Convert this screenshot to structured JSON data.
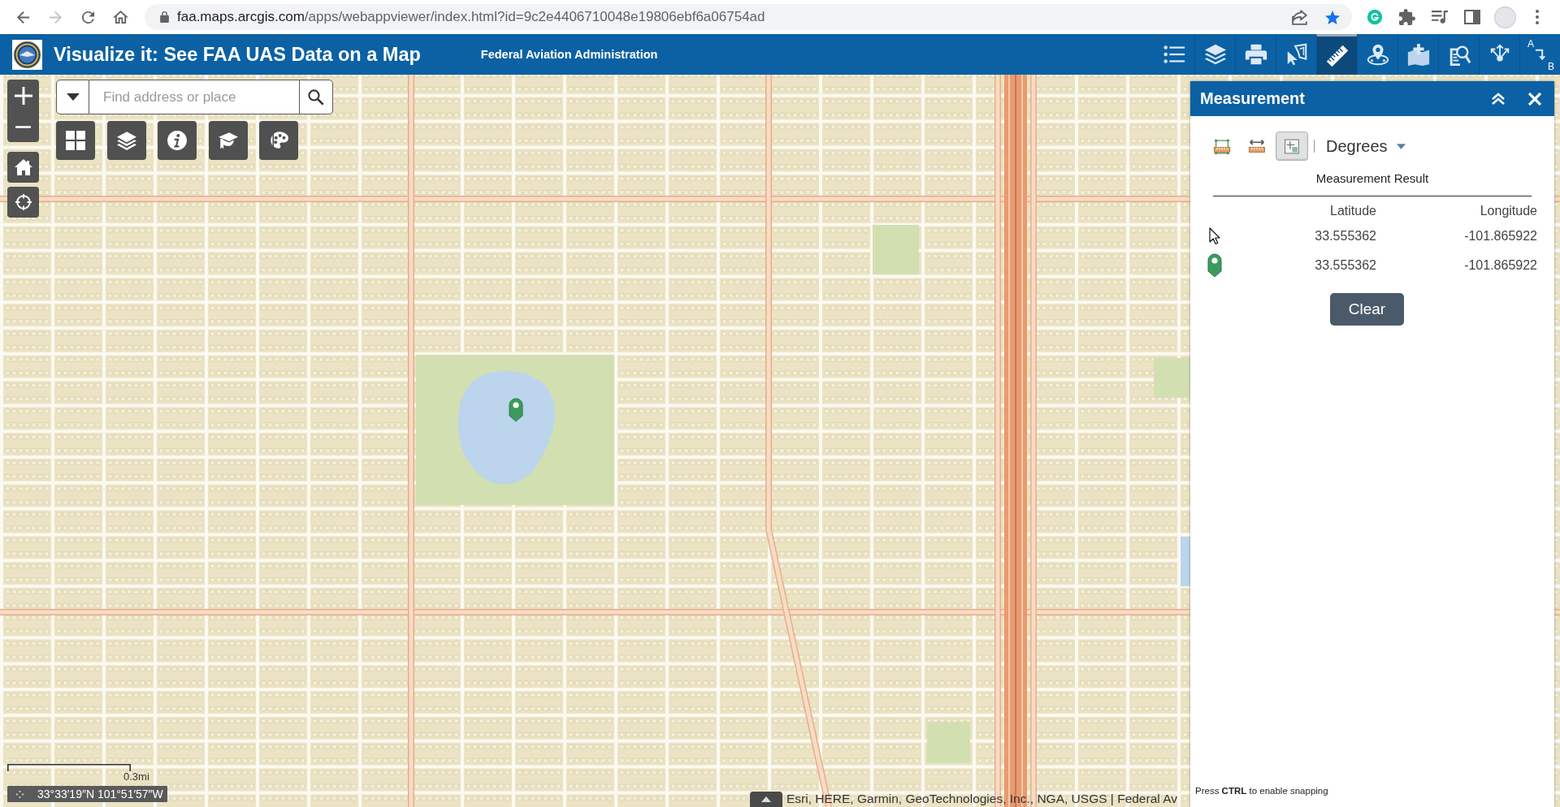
{
  "browser": {
    "nav_buttons": [
      {
        "kind": "back",
        "disabled": false
      },
      {
        "kind": "forward",
        "disabled": true
      },
      {
        "kind": "reload",
        "disabled": false
      },
      {
        "kind": "home",
        "disabled": false
      }
    ],
    "url": "faa.maps.arcgis.com/apps/webappviewer/index.html?id=9c2e4406710048e19806ebf6a06754ad",
    "bookmarked": true,
    "extensions": [
      {
        "kind": "grammarly"
      },
      {
        "kind": "puzzle"
      },
      {
        "kind": "media"
      },
      {
        "kind": "sidebar"
      },
      {
        "kind": "profile"
      },
      {
        "kind": "menu"
      }
    ]
  },
  "header": {
    "title": "Visualize it: See FAA UAS Data on a Map",
    "subtitle": "Federal Aviation Administration",
    "tools": [
      {
        "kind": "legend",
        "selected": false
      },
      {
        "kind": "layers",
        "selected": false
      },
      {
        "kind": "print",
        "selected": false
      },
      {
        "kind": "select",
        "selected": false
      },
      {
        "kind": "measure",
        "selected": true
      },
      {
        "kind": "coordinates",
        "selected": false
      },
      {
        "kind": "add_data",
        "selected": false
      },
      {
        "kind": "query",
        "selected": false
      },
      {
        "kind": "share",
        "selected": false
      },
      {
        "kind": "directions",
        "selected": false,
        "from_label": "A",
        "to_label": "B"
      }
    ]
  },
  "map": {
    "search": {
      "placeholder": "Find address or place"
    },
    "widgets": [
      {
        "kind": "basemap"
      },
      {
        "kind": "layers"
      },
      {
        "kind": "about"
      },
      {
        "kind": "education"
      },
      {
        "kind": "style"
      }
    ],
    "scale_label": "0.3mi",
    "coordinates": "33°33′19″N 101°51′57″W",
    "attribution": "Esri, HERE, Garmin, GeoTechnologies, Inc., NGA, USGS | Federal Av"
  },
  "panel": {
    "title": "Measurement",
    "tools": [
      {
        "kind": "area",
        "selected": false
      },
      {
        "kind": "distance",
        "selected": false
      },
      {
        "kind": "location",
        "selected": true
      }
    ],
    "unit": "Degrees",
    "result_title": "Measurement Result",
    "columns": [
      "Latitude",
      "Longitude"
    ],
    "rows": [
      {
        "kind": "cursor",
        "latitude": "33.555362",
        "longitude": "-101.865922"
      },
      {
        "kind": "marker",
        "latitude": "33.555362",
        "longitude": "-101.865922"
      }
    ],
    "button": "Clear",
    "hint": "Press **CTRL** to enable snapping"
  }
}
